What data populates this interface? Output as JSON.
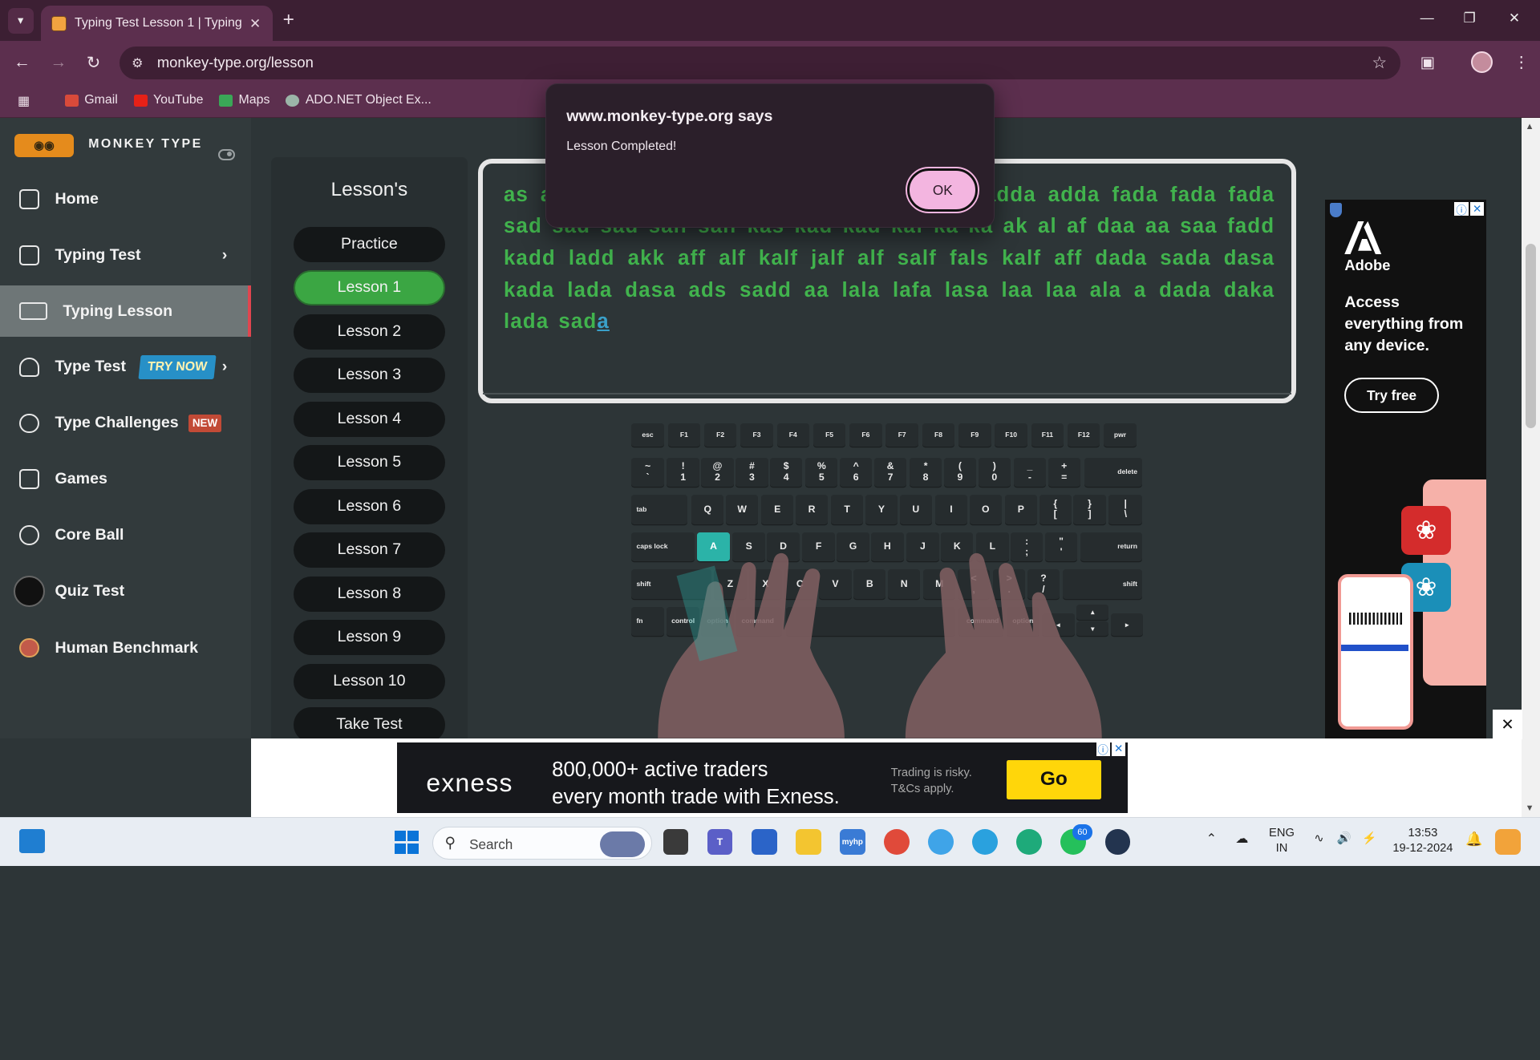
{
  "browser": {
    "tab_title": "Typing Test Lesson 1 | Typing Te",
    "url": "monkey-type.org/lesson",
    "bookmarks": [
      "Gmail",
      "YouTube",
      "Maps",
      "ADO.NET Object Ex..."
    ]
  },
  "sidebar": {
    "brand": "MONKEY TYPE",
    "items": [
      {
        "label": "Home",
        "icon": "home-icon"
      },
      {
        "label": "Typing Test",
        "icon": "keyboard-test-icon"
      },
      {
        "label": "Typing Lesson",
        "icon": "keyboard-icon"
      },
      {
        "label": "Type Test",
        "icon": "gauge-icon",
        "badge": "TRY NOW"
      },
      {
        "label": "Type Challenges",
        "icon": "trophy-icon",
        "badge": "NEW"
      },
      {
        "label": "Games",
        "icon": "grid-icon"
      },
      {
        "label": "Core Ball",
        "icon": "target-icon"
      },
      {
        "label": "Quiz Test",
        "icon": "quiz-icon"
      },
      {
        "label": "Human Benchmark",
        "icon": "brain-icon"
      }
    ]
  },
  "lessons": {
    "title": "Lesson's",
    "buttons": [
      "Practice",
      "Lesson 1",
      "Lesson 2",
      "Lesson 3",
      "Lesson 4",
      "Lesson 5",
      "Lesson 6",
      "Lesson 7",
      "Lesson 8",
      "Lesson 9",
      "Lesson 10",
      "Take Test"
    ],
    "active": "Lesson 1"
  },
  "typing": {
    "text": "as a  d lala lala lala dada dada dada  add adda adda fada fada fada sad sad sad salf salf kas kad kad kaf ka ka ak al af daa aa saa fadd kadd ladd akk aff alf kalf jalf alf salf fals kalf aff dada sada dasa kada lada dasa ads sadd aa lala lafa lasa laa laa ala a dada daka lada sad",
    "cursor_char": "a"
  },
  "keyboard": {
    "highlighted_key": "A"
  },
  "dialog": {
    "title": "www.monkey-type.org says",
    "message": "Lesson Completed!",
    "ok_label": "OK"
  },
  "ad_right": {
    "brand": "Adobe",
    "headline": "Access everything from any device.",
    "cta": "Try free"
  },
  "ad_bottom": {
    "logo": "exness",
    "headline_line1": "800,000+ active traders",
    "headline_line2": "every month trade with Exness.",
    "risk_line1": "Trading is risky.",
    "risk_line2": "T&Cs apply.",
    "cta": "Go"
  },
  "taskbar": {
    "search_placeholder": "Search",
    "lang_line1": "ENG",
    "lang_line2": "IN",
    "time": "13:53",
    "date": "19-12-2024",
    "whatsapp_badge": "60"
  }
}
